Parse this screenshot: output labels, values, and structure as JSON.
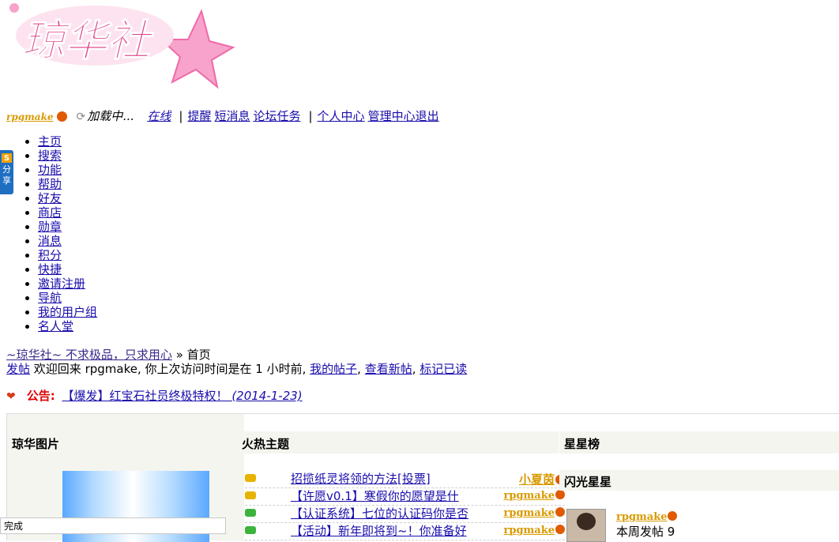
{
  "logo": {
    "text": "琼华社",
    "colors": {
      "pink": "#f06aa8",
      "star": "#f58cbf"
    }
  },
  "topbar": {
    "username": "rpgmake",
    "loading": "加载中...",
    "online": "在线",
    "links": [
      "提醒",
      "短消息",
      "论坛任务",
      "个人中心",
      "管理中心退出"
    ]
  },
  "share": {
    "label": "分享"
  },
  "nav": [
    "主页",
    "搜索",
    "功能",
    "帮助",
    "好友",
    "商店",
    "勋章",
    "消息",
    "积分",
    "快捷",
    "邀请注册",
    "导航",
    "我的用户组",
    "名人堂"
  ],
  "breadcrumb": {
    "site": "~琼华社~ 不求极品，只求用心",
    "sep": "»",
    "current": "首页"
  },
  "welcome": {
    "post": "发帖",
    "text": "欢迎回来 rpgmake, 你上次访问时间是在 1 小时前,",
    "my_posts": "我的帖子",
    "comma1": ",",
    "new_posts": "查看新帖",
    "comma2": ",",
    "mark_read": "标记已读"
  },
  "notice": {
    "label": "公告:",
    "title": "【爆发】红宝石社员终极特权！",
    "date": "(2014-1-23)"
  },
  "panels": {
    "pictures": "琼华图片",
    "hot": "火热主题",
    "stars": "星星榜",
    "flash": "闪光星星"
  },
  "hot_topics": [
    {
      "title": "招揽纸灵将领的方法[投票]",
      "author": "小夏茵"
    },
    {
      "title": "【许愿v0.1】寒假你的愿望是什",
      "author": "rpgmake"
    },
    {
      "title": "【认证系统】七位的认证码你是否",
      "author": "rpgmake"
    },
    {
      "title": "【活动】新年即将到~！你准备好",
      "author": "rpgmake"
    }
  ],
  "star_user": {
    "name": "rpgmake",
    "posts_label": "本周发帖",
    "posts": "9"
  },
  "status": "完成"
}
